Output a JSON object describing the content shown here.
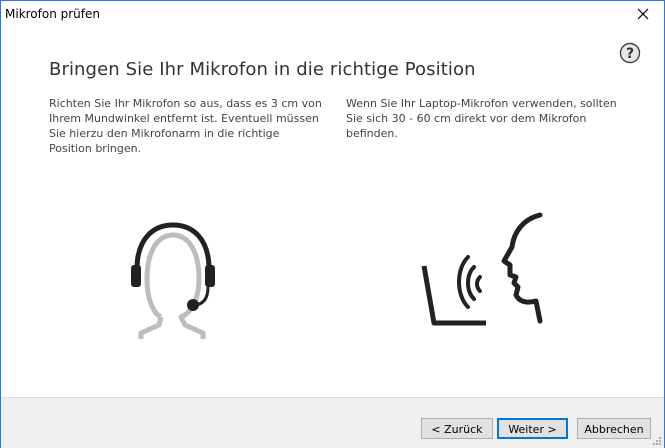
{
  "window": {
    "title": "Mikrofon prüfen"
  },
  "content": {
    "heading": "Bringen Sie Ihr Mikrofon in die richtige Position",
    "left_text": "Richten Sie Ihr Mikrofon so aus, dass es 3 cm von Ihrem Mundwinkel entfernt ist. Eventuell müssen Sie hierzu den Mikrofonarm in die richtige Position bringen.",
    "right_text": "Wenn Sie Ihr Laptop-Mikrofon verwenden, sollten Sie sich 30 - 60 cm direkt vor dem Mikrofon befinden."
  },
  "buttons": {
    "back": "< Zurück",
    "next": "Weiter >",
    "cancel": "Abbrechen"
  },
  "icons": {
    "help": "help-icon",
    "close": "close-icon",
    "headset": "headset-illustration",
    "laptop": "laptop-speaking-illustration"
  },
  "colors": {
    "border": "#2b79d7",
    "heading": "#333333",
    "headset_gray": "#bdbdbd",
    "dark": "#222222",
    "accent_button": "#0078d7"
  }
}
